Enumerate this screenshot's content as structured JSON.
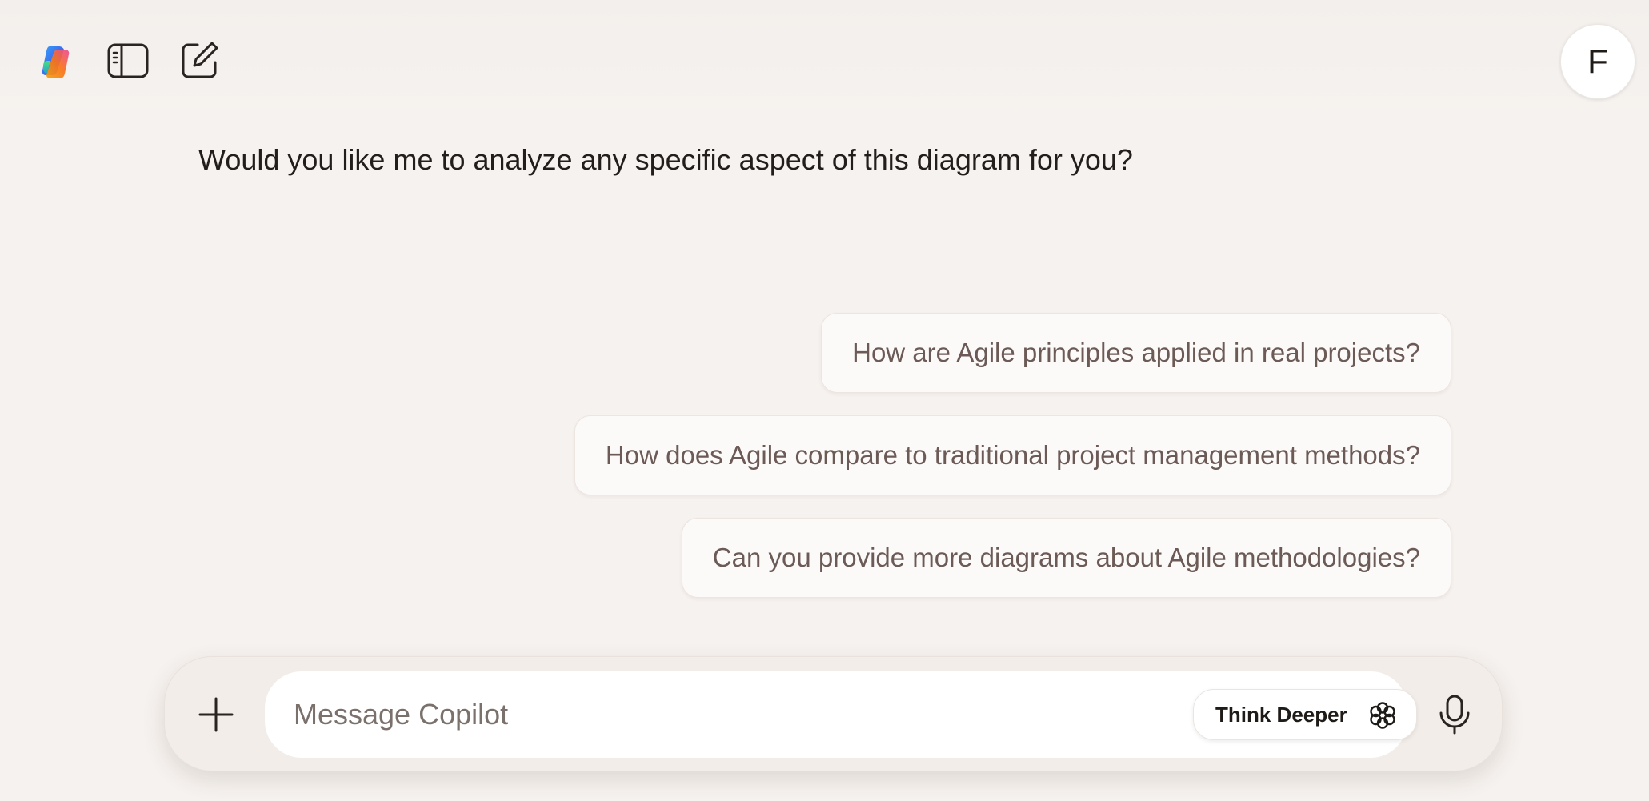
{
  "header": {
    "logo_icon": "copilot-logo-icon",
    "sidebar_icon": "sidebar-toggle-icon",
    "new_chat_icon": "new-chat-icon",
    "avatar_initial": "F"
  },
  "conversation": {
    "assistant_message": "Would you like me to analyze any specific aspect of this diagram for you?"
  },
  "suggestions": [
    {
      "label": "How are Agile principles applied in real projects?"
    },
    {
      "label": "How does Agile compare to traditional project management methods?"
    },
    {
      "label": "Can you provide more diagrams about Agile methodologies?"
    }
  ],
  "composer": {
    "placeholder": "Message Copilot",
    "value": "",
    "think_deeper_label": "Think Deeper",
    "plus_icon": "plus-icon",
    "think_icon": "think-deeper-icon",
    "mic_icon": "microphone-icon"
  },
  "colors": {
    "background": "#f6f2ef",
    "suggestion_text": "#6b5a55",
    "logo_gradient": [
      "#3fa6f5",
      "#8b5cf6",
      "#f97316",
      "#22c55e"
    ]
  }
}
